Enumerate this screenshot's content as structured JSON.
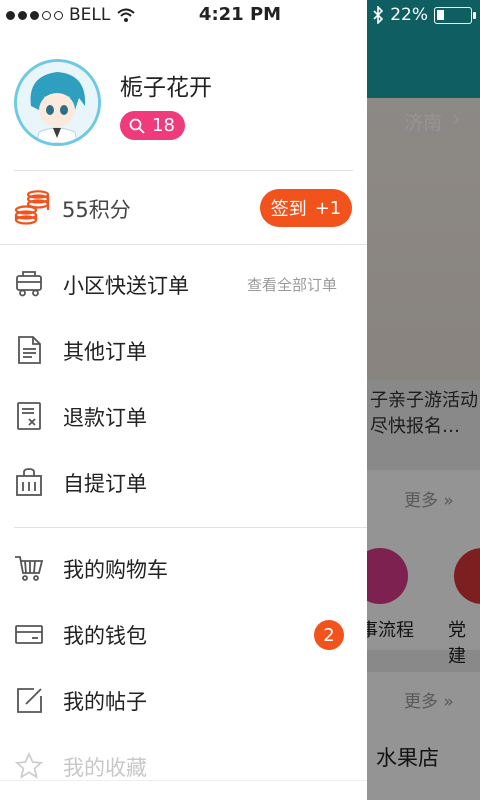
{
  "status_bar": {
    "carrier": "BELL",
    "time": "4:21 PM",
    "battery": "22%",
    "battery_level": 0.22,
    "signal_bars": 3
  },
  "background": {
    "city": "济南",
    "promo_line1": "子亲子游活动",
    "promo_line2": "尽快报名…",
    "more_label_1": "更多",
    "more_label_2": "更多",
    "category_1": "事流程",
    "category_2": "党建",
    "shop_title": "水果店"
  },
  "drawer": {
    "profile": {
      "username": "栀子花开",
      "level": "18"
    },
    "points": {
      "text": "55积分",
      "signin_label": "签到",
      "signin_bonus": "+1"
    },
    "menu": [
      {
        "label": "小区快送订单",
        "aux": "查看全部订单",
        "icon": "delivery-truck-icon"
      },
      {
        "label": "其他订单",
        "icon": "document-icon"
      },
      {
        "label": "退款订单",
        "icon": "refund-receipt-icon"
      },
      {
        "label": "自提订单",
        "icon": "shopping-bag-icon"
      },
      {
        "label": "我的购物车",
        "icon": "cart-icon"
      },
      {
        "label": "我的钱包",
        "badge": "2",
        "icon": "wallet-icon"
      },
      {
        "label": "我的帖子",
        "icon": "edit-post-icon"
      },
      {
        "label": "我的收藏",
        "icon": "star-icon"
      }
    ]
  },
  "colors": {
    "accent_orange": "#f2521c",
    "level_pink": "#ef3a7b",
    "teal_header": "#1aa3a8"
  }
}
